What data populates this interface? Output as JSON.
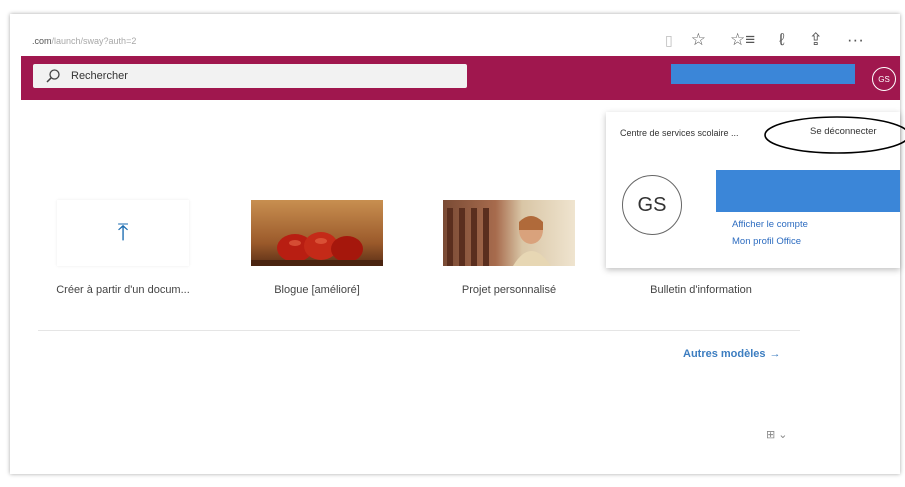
{
  "browser": {
    "url_domain": ".com",
    "url_path": "/launch/sway?auth=2",
    "icons": [
      "reading-view-icon",
      "favorite-star-icon",
      "favorites-list-icon",
      "pen-icon",
      "share-icon",
      "more-icon"
    ],
    "icon_glyphs": {
      "reading": "▯",
      "star": "☆",
      "favlist": "☆≡",
      "pen": "ℓ",
      "share": "⇪",
      "more": "···"
    }
  },
  "appbar": {
    "color": "#a0174e",
    "search_placeholder": "Rechercher",
    "avatar_initials": "GS"
  },
  "templates": [
    {
      "label": "Créer à partir d'un docum..."
    },
    {
      "label": "Blogue [amélioré]"
    },
    {
      "label": "Projet personnalisé"
    },
    {
      "label": "Bulletin d'information"
    }
  ],
  "upload_icon_glyph": "⤒",
  "more_templates": {
    "label": "Autres modèles",
    "arrow": "→"
  },
  "view_toggle": "⊞ ⌄",
  "account_popup": {
    "organization": "Centre de services scolaire ...",
    "signout": "Se déconnecter",
    "initials": "GS",
    "view_account": "Afficher le compte",
    "office_profile": "Mon profil Office"
  },
  "colors": {
    "accent_link": "#2d6cc0",
    "redaction_blue": "#3b86d8"
  }
}
